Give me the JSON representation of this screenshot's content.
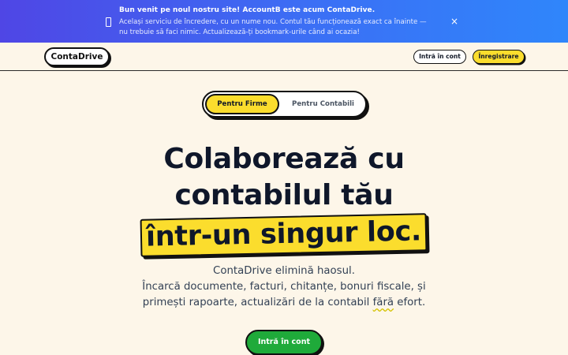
{
  "banner": {
    "title": "Bun venit pe noul nostru site! AccountB este acum ContaDrive.",
    "text": "Același serviciu de încredere, cu un nume nou. Contul tău funcționează exact ca înainte — nu trebuie să faci nimic. Actualizează-ți bookmark-urile când ai ocazia!",
    "close_label": "×",
    "icon": "phone-icon"
  },
  "nav": {
    "logo": "ContaDrive",
    "login_label": "Intră în cont",
    "register_label": "Înregistrare"
  },
  "toggle": {
    "firme_label": "Pentru Firme",
    "contabili_label": "Pentru Contabili",
    "active": "firme"
  },
  "hero": {
    "line1": "Colaborează cu",
    "line2": "contabilul tău",
    "highlight": "într-un singur loc.",
    "sub1": "ContaDrive elimină haosul.",
    "sub2": "Încarcă documente, facturi, chitanțe, bonuri fiscale, și",
    "sub3_pre": "primești rapoarte, actualizări de la contabil ",
    "sub3_underlined": "fără",
    "sub3_post": " efort.",
    "cta_label": "Intră în cont"
  },
  "colors": {
    "accent_yellow": "#fbdd2d",
    "cta_green": "#1faa3a",
    "banner_start": "#4f46e5",
    "banner_end": "#2f86fb",
    "background": "#fdf6e9"
  }
}
